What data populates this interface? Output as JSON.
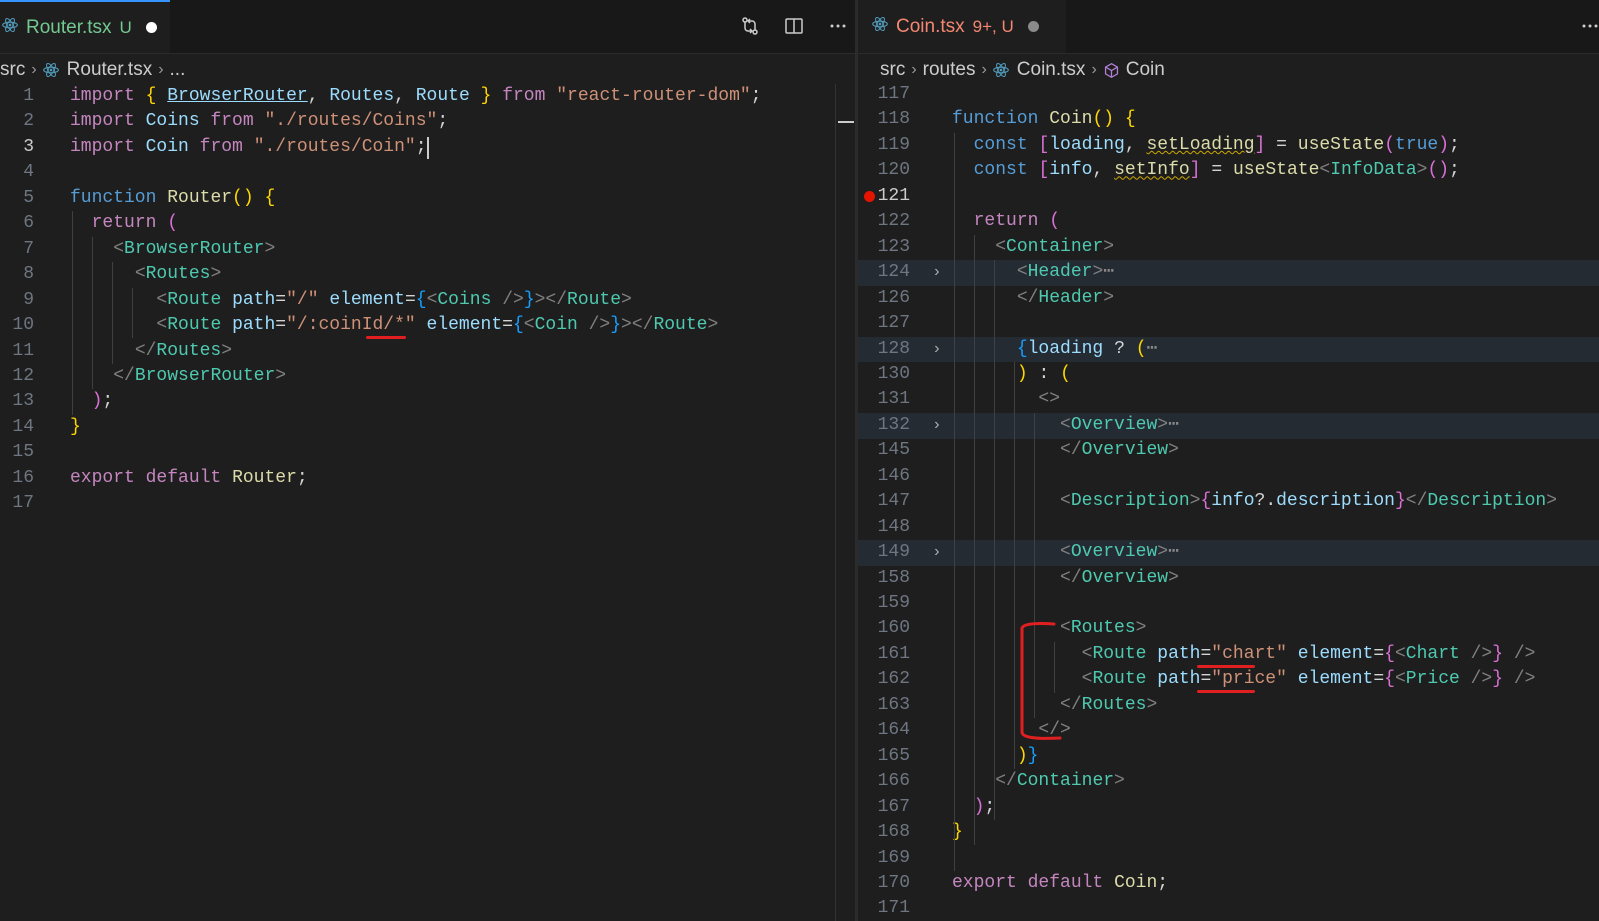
{
  "left": {
    "tab": {
      "filename": "Router.tsx",
      "status": "U",
      "color": "#73c991"
    },
    "actions": [
      "compare-changes-icon",
      "split-editor-icon",
      "more-actions-icon"
    ],
    "breadcrumb": [
      "src",
      "Router.tsx",
      "..."
    ],
    "active_line": "3",
    "lines": [
      {
        "n": "1",
        "html": "<span class='k'>import</span> <span class='b1'>{</span> <span class='v u'>BrowserRouter</span><span class='p'>,</span> <span class='v'>Routes</span><span class='p'>,</span> <span class='v'>Route</span> <span class='b1'>}</span> <span class='k'>from</span> <span class='s'>\"react-router-dom\"</span><span class='p'>;</span>"
      },
      {
        "n": "2",
        "html": "<span class='k'>import</span> <span class='v'>Coins</span> <span class='k'>from</span> <span class='s'>\"./routes/Coins\"</span><span class='p'>;</span>"
      },
      {
        "n": "3",
        "html": "<span class='k'>import</span> <span class='v'>Coin</span> <span class='k'>from</span> <span class='s'>\"./routes/Coin\"</span><span class='p'>;</span>"
      },
      {
        "n": "4",
        "html": ""
      },
      {
        "n": "5",
        "html": "<span class='kb'>function</span> <span class='f'>Router</span><span class='b1'>()</span> <span class='b1'>{</span>"
      },
      {
        "n": "6",
        "html": "  <span class='k'>return</span> <span class='b2'>(</span>"
      },
      {
        "n": "7",
        "html": "    <span class='tg'>&lt;</span><span class='t'>BrowserRouter</span><span class='tg'>&gt;</span>"
      },
      {
        "n": "8",
        "html": "      <span class='tg'>&lt;</span><span class='t'>Routes</span><span class='tg'>&gt;</span>"
      },
      {
        "n": "9",
        "html": "        <span class='tg'>&lt;</span><span class='t'>Route</span> <span class='v'>path</span><span class='p'>=</span><span class='s'>\"/\"</span> <span class='v'>element</span><span class='p'>=</span><span class='b3'>{</span><span class='tg'>&lt;</span><span class='t'>Coins</span> <span class='tg'>/&gt;</span><span class='b3'>}</span><span class='tg'>&gt;&lt;/</span><span class='t'>Route</span><span class='tg'>&gt;</span>"
      },
      {
        "n": "10",
        "html": "        <span class='tg'>&lt;</span><span class='t'>Route</span> <span class='v'>path</span><span class='p'>=</span><span class='s'>\"/:coinId/*\"</span> <span class='v'>element</span><span class='p'>=</span><span class='b3'>{</span><span class='tg'>&lt;</span><span class='t'>Coin</span> <span class='tg'>/&gt;</span><span class='b3'>}</span><span class='tg'>&gt;&lt;/</span><span class='t'>Route</span><span class='tg'>&gt;</span>"
      },
      {
        "n": "11",
        "html": "      <span class='tg'>&lt;/</span><span class='t'>Routes</span><span class='tg'>&gt;</span>"
      },
      {
        "n": "12",
        "html": "    <span class='tg'>&lt;/</span><span class='t'>BrowserRouter</span><span class='tg'>&gt;</span>"
      },
      {
        "n": "13",
        "html": "  <span class='b2'>)</span><span class='p'>;</span>"
      },
      {
        "n": "14",
        "html": "<span class='b1'>}</span>"
      },
      {
        "n": "15",
        "html": ""
      },
      {
        "n": "16",
        "html": "<span class='k'>export</span> <span class='k'>default</span> <span class='f'>Router</span><span class='p'>;</span>"
      },
      {
        "n": "17",
        "html": ""
      }
    ]
  },
  "right": {
    "tab": {
      "filename": "Coin.tsx",
      "status": "9+, U",
      "color": "#f48771"
    },
    "breadcrumb": [
      "src",
      "routes",
      "Coin.tsx",
      "Coin"
    ],
    "active_line": "121",
    "lines": [
      {
        "n": "117",
        "html": ""
      },
      {
        "n": "118",
        "html": "<span class='kb'>function</span> <span class='f'>Coin</span><span class='b1'>()</span> <span class='b1'>{</span>"
      },
      {
        "n": "119",
        "html": "  <span class='kb'>const</span> <span class='b2'>[</span><span class='v'>loading</span><span class='p'>,</span> <span class='f squig'>setLoading</span><span class='b2'>]</span> <span class='p'>=</span> <span class='f'>useState</span><span class='b2'>(</span><span class='kb'>true</span><span class='b2'>)</span><span class='p'>;</span>"
      },
      {
        "n": "120",
        "html": "  <span class='kb'>const</span> <span class='b2'>[</span><span class='v'>info</span><span class='p'>,</span> <span class='f squig'>setInfo</span><span class='b2'>]</span> <span class='p'>=</span> <span class='f'>useState</span><span class='tg'>&lt;</span><span class='t'>InfoData</span><span class='tg'>&gt;</span><span class='b2'>()</span><span class='p'>;</span>"
      },
      {
        "n": "121",
        "html": ""
      },
      {
        "n": "122",
        "html": "  <span class='k'>return</span> <span class='b2'>(</span>"
      },
      {
        "n": "123",
        "html": "    <span class='tg'>&lt;</span><span class='t'>Container</span><span class='tg'>&gt;</span>"
      },
      {
        "n": "124",
        "html": "      <span class='tg'>&lt;</span><span class='t'>Header</span><span class='tg'>&gt;</span><span class='ell'>⋯</span>"
      },
      {
        "n": "126",
        "html": "      <span class='tg'>&lt;/</span><span class='t'>Header</span><span class='tg'>&gt;</span>"
      },
      {
        "n": "127",
        "html": ""
      },
      {
        "n": "128",
        "html": "      <span class='b3'>{</span><span class='v'>loading</span> <span class='p'>?</span> <span class='b1'>(</span><span class='ell'>⋯</span>"
      },
      {
        "n": "130",
        "html": "      <span class='b1'>)</span> <span class='p'>:</span> <span class='b1'>(</span>"
      },
      {
        "n": "131",
        "html": "        <span class='tg'>&lt;&gt;</span>"
      },
      {
        "n": "132",
        "html": "          <span class='tg'>&lt;</span><span class='t'>Overview</span><span class='tg'>&gt;</span><span class='ell'>⋯</span>"
      },
      {
        "n": "145",
        "html": "          <span class='tg'>&lt;/</span><span class='t'>Overview</span><span class='tg'>&gt;</span>"
      },
      {
        "n": "146",
        "html": ""
      },
      {
        "n": "147",
        "html": "          <span class='tg'>&lt;</span><span class='t'>Description</span><span class='tg'>&gt;</span><span class='b2'>{</span><span class='v'>info</span><span class='p'>?.</span><span class='v'>description</span><span class='b2'>}</span><span class='tg'>&lt;/</span><span class='t'>Description</span><span class='tg'>&gt;</span>"
      },
      {
        "n": "148",
        "html": ""
      },
      {
        "n": "149",
        "html": "          <span class='tg'>&lt;</span><span class='t'>Overview</span><span class='tg'>&gt;</span><span class='ell'>⋯</span>"
      },
      {
        "n": "158",
        "html": "          <span class='tg'>&lt;/</span><span class='t'>Overview</span><span class='tg'>&gt;</span>"
      },
      {
        "n": "159",
        "html": ""
      },
      {
        "n": "160",
        "html": "          <span class='tg'>&lt;</span><span class='t'>Routes</span><span class='tg'>&gt;</span>"
      },
      {
        "n": "161",
        "html": "            <span class='tg'>&lt;</span><span class='t'>Route</span> <span class='v'>path</span><span class='p'>=</span><span class='s'>\"chart\"</span> <span class='v'>element</span><span class='p'>=</span><span class='b2'>{</span><span class='tg'>&lt;</span><span class='t'>Chart</span> <span class='tg'>/&gt;</span><span class='b2'>}</span> <span class='tg'>/&gt;</span>"
      },
      {
        "n": "162",
        "html": "            <span class='tg'>&lt;</span><span class='t'>Route</span> <span class='v'>path</span><span class='p'>=</span><span class='s'>\"price\"</span> <span class='v'>element</span><span class='p'>=</span><span class='b2'>{</span><span class='tg'>&lt;</span><span class='t'>Price</span> <span class='tg'>/&gt;</span><span class='b2'>}</span> <span class='tg'>/&gt;</span>"
      },
      {
        "n": "163",
        "html": "          <span class='tg'>&lt;/</span><span class='t'>Routes</span><span class='tg'>&gt;</span>"
      },
      {
        "n": "164",
        "html": "        <span class='tg'>&lt;/&gt;</span>"
      },
      {
        "n": "165",
        "html": "      <span class='b1'>)</span><span class='b3'>}</span>"
      },
      {
        "n": "166",
        "html": "    <span class='tg'>&lt;/</span><span class='t'>Container</span><span class='tg'>&gt;</span>"
      },
      {
        "n": "167",
        "html": "  <span class='b2'>)</span><span class='p'>;</span>"
      },
      {
        "n": "168",
        "html": "<span class='b1'>}</span>"
      },
      {
        "n": "169",
        "html": ""
      },
      {
        "n": "170",
        "html": "<span class='k'>export</span> <span class='k'>default</span> <span class='f'>Coin</span><span class='p'>;</span>"
      },
      {
        "n": "171",
        "html": ""
      }
    ]
  },
  "colors": {
    "react_icon": "#519aba",
    "breakpoint": "#e51400",
    "annotation": "#e02020"
  }
}
